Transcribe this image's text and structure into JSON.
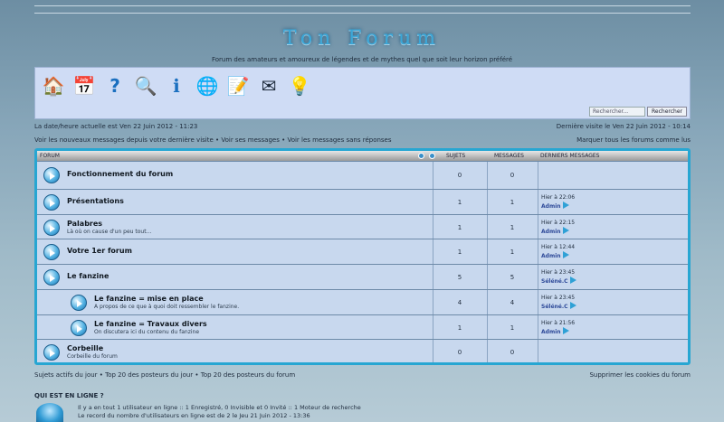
{
  "header": {
    "logo_text": "Ton Forum",
    "tagline": "Forum des amateurs et amoureux de légendes et de mythes quel que soit leur horizon préféré"
  },
  "nav": {
    "icons": [
      "home-icon",
      "calendar-icon",
      "faq-icon",
      "search-icon",
      "member-icon",
      "groups-icon",
      "profile-icon",
      "messages-icon",
      "login-icon"
    ],
    "search_placeholder": "Rechercher...",
    "search_button": "Rechercher"
  },
  "datebar": {
    "current": "La date/heure actuelle est Ven 22 Juin 2012 - 11:23",
    "last_visit": "Dernière visite le Ven 22 Juin 2012 - 10:14"
  },
  "links": {
    "left": "Voir les nouveaux messages depuis votre dernière visite • Voir ses messages • Voir les messages sans réponses",
    "right": "Marquer tous les forums comme lus"
  },
  "table": {
    "headers": {
      "forum": "FORUM",
      "topics": "SUJETS",
      "messages": "MESSAGES",
      "last": "DERNIERS MESSAGES"
    },
    "rows": [
      {
        "title": "Fonctionnement du forum",
        "desc": "",
        "topics": "0",
        "messages": "0",
        "last_time": "",
        "last_by": "",
        "sub": false
      },
      {
        "title": "Présentations",
        "desc": "",
        "topics": "1",
        "messages": "1",
        "last_time": "Hier à 22:06",
        "last_by": "Admin",
        "sub": false
      },
      {
        "title": "Palabres",
        "desc": "Là où on cause d'un peu tout...",
        "topics": "1",
        "messages": "1",
        "last_time": "Hier à 22:15",
        "last_by": "Admin",
        "sub": false
      },
      {
        "title": "Votre 1er forum",
        "desc": "",
        "topics": "1",
        "messages": "1",
        "last_time": "Hier à 12:44",
        "last_by": "Admin",
        "sub": false
      },
      {
        "title": "Le fanzine",
        "desc": "",
        "topics": "5",
        "messages": "5",
        "last_time": "Hier à 23:45",
        "last_by": "Séléné.C",
        "sub": false
      },
      {
        "title": "Le fanzine = mise en place",
        "desc": "A propos de ce que à quoi doit ressembler le fanzine.",
        "topics": "4",
        "messages": "4",
        "last_time": "Hier à 23:45",
        "last_by": "Séléné.C",
        "sub": true
      },
      {
        "title": "Le fanzine = Travaux divers",
        "desc": "On discutera ici du contenu du fanzine",
        "topics": "1",
        "messages": "1",
        "last_time": "Hier à 21:56",
        "last_by": "Admin",
        "sub": true
      },
      {
        "title": "Corbeille",
        "desc": "Corbeille du forum",
        "topics": "0",
        "messages": "0",
        "last_time": "",
        "last_by": "",
        "sub": false
      }
    ]
  },
  "footer": {
    "left": "Sujets actifs du jour • Top 20 des posteurs du jour • Top 20 des posteurs du forum",
    "right": "Supprimer les cookies du forum",
    "who_title": "QUI EST EN LIGNE ?",
    "who_line1": "Il y a en tout 1 utilisateur en ligne :: 1 Enregistré, 0 Invisible et 0 Invité :: 1 Moteur de recherche",
    "who_line2": "Le record du nombre d'utilisateurs en ligne est de 2 le Jeu 21 Juin 2012 - 13:36"
  }
}
